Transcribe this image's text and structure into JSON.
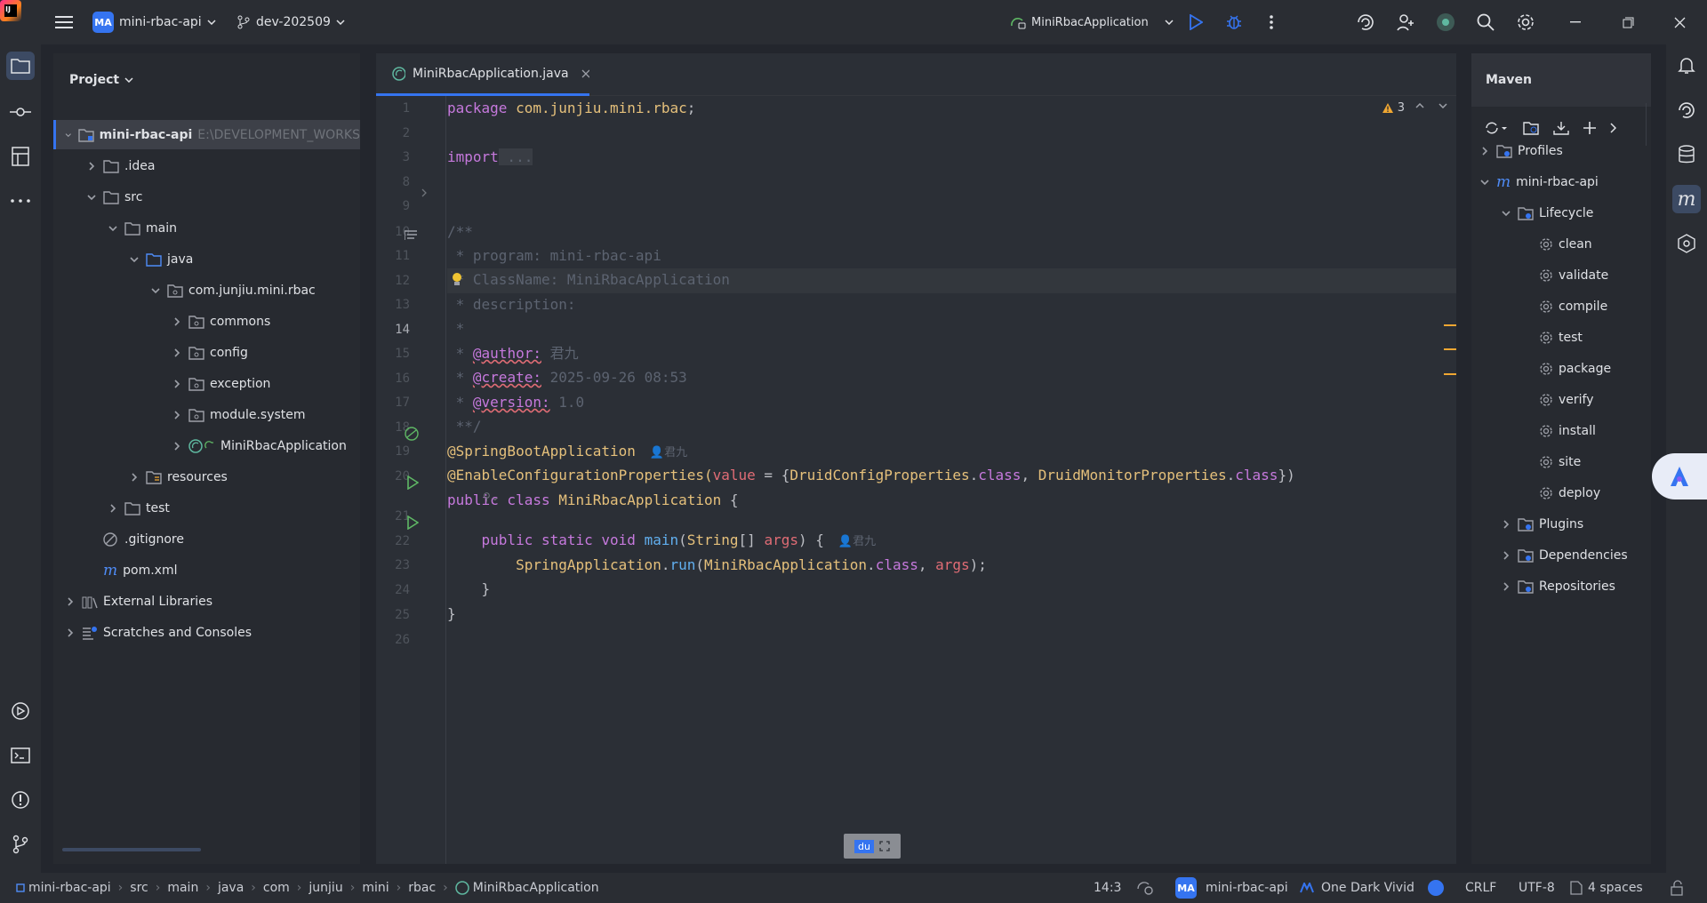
{
  "titlebar": {
    "project_badge": "MA",
    "project_name": "mini-rbac-api",
    "branch": "dev-202509",
    "run_config": "MiniRbacApplication",
    "logo_text": "IJ"
  },
  "project_panel": {
    "title": "Project",
    "tree": [
      {
        "label": "mini-rbac-api",
        "hint": "E:\\DEVELOPMENT_WORKS",
        "icon": "module-folder",
        "depth": 0,
        "expanded": true
      },
      {
        "label": ".idea",
        "icon": "folder",
        "depth": 1,
        "expanded": false
      },
      {
        "label": "src",
        "icon": "folder",
        "depth": 1,
        "expanded": true
      },
      {
        "label": "main",
        "icon": "folder",
        "depth": 2,
        "expanded": true
      },
      {
        "label": "java",
        "icon": "source-folder",
        "depth": 3,
        "expanded": true
      },
      {
        "label": "com.junjiu.mini.rbac",
        "icon": "package",
        "depth": 4,
        "expanded": true
      },
      {
        "label": "commons",
        "icon": "package",
        "depth": 5,
        "expanded": false
      },
      {
        "label": "config",
        "icon": "package",
        "depth": 5,
        "expanded": false
      },
      {
        "label": "exception",
        "icon": "package",
        "depth": 5,
        "expanded": false
      },
      {
        "label": "module.system",
        "icon": "package",
        "depth": 5,
        "expanded": false
      },
      {
        "label": "MiniRbacApplication",
        "icon": "spring-class",
        "depth": 5,
        "expanded": false
      },
      {
        "label": "resources",
        "icon": "resources-folder",
        "depth": 3,
        "expanded": false
      },
      {
        "label": "test",
        "icon": "folder",
        "depth": 2,
        "expanded": false
      },
      {
        "label": ".gitignore",
        "icon": "ignore-file",
        "depth": 1
      },
      {
        "label": "pom.xml",
        "icon": "maven-file",
        "depth": 1
      },
      {
        "label": "External Libraries",
        "icon": "libraries",
        "depth": 0,
        "expanded": false
      },
      {
        "label": "Scratches and Consoles",
        "icon": "scratches",
        "depth": 0,
        "expanded": false
      }
    ]
  },
  "editor": {
    "tab_label": "MiniRbacApplication.java",
    "warnings_count": "3",
    "line_numbers": [
      "1",
      "2",
      "3",
      "8",
      "9",
      "10",
      "11",
      "12",
      "13",
      "14",
      "15",
      "16",
      "17",
      "18",
      "19",
      "20",
      "21",
      "22",
      "23",
      "24",
      "25",
      "26"
    ],
    "lines": {
      "l1_kw": "package",
      "l1_pkg": " com.junjiu.mini.rbac",
      "l1_end": ";",
      "l3_kw": "import",
      "l3_rest": " ...",
      "l10": "/**",
      "l11": " * program: mini-rbac-api",
      "l12": " * ClassName: MiniRbacApplication",
      "l13": " * description:",
      "l14": " *",
      "l15_pre": " * ",
      "l15_tag": "@author:",
      "l15_val": " 君九",
      "l16_pre": " * ",
      "l16_tag": "@create:",
      "l16_val": " 2025-09-26 08:53",
      "l17_pre": " * ",
      "l17_tag": "@version:",
      "l17_val": " 1.0",
      "l18": " **/",
      "l19_ann": "@SpringBootApplication",
      "l19_author": "君九",
      "l20_ann": "@EnableConfigurationProperties(",
      "l20_param": "value",
      "l20_mid": " = {",
      "l20_c1": "DruidConfigProperties",
      "l20_dot1": ".",
      "l20_class1": "class",
      "l20_comma": ", ",
      "l20_c2": "DruidMonitorProperties",
      "l20_dot2": ".",
      "l20_class2": "class",
      "l20_end": "})",
      "l21_kw": "public class ",
      "l21_name": "MiniRbacApplication",
      "l21_end": " {",
      "l22_kw": "    public static void ",
      "l22_fn": "main",
      "l22_open": "(",
      "l22_type": "String",
      "l22_arr": "[] ",
      "l22_param": "args",
      "l22_end": ") {",
      "l22_author": "君九",
      "l23_cls": "        SpringApplication",
      "l23_dot": ".",
      "l23_fn": "run",
      "l23_open": "(",
      "l23_cls2": "MiniRbacApplication",
      "l23_dot2": ".",
      "l23_kw": "class",
      "l23_comma": ", ",
      "l23_param": "args",
      "l23_end": ");",
      "l24": "    }",
      "l25": "}"
    },
    "floating_toolbar_label": "du"
  },
  "maven_panel": {
    "title": "Maven",
    "items": [
      {
        "label": "Profiles",
        "icon": "profiles-folder",
        "depth": 0
      },
      {
        "label": "mini-rbac-api",
        "icon": "maven-module",
        "depth": 0
      },
      {
        "label": "Lifecycle",
        "icon": "lifecycle-folder",
        "depth": 1
      },
      {
        "label": "clean",
        "icon": "gear",
        "depth": 2
      },
      {
        "label": "validate",
        "icon": "gear",
        "depth": 2
      },
      {
        "label": "compile",
        "icon": "gear",
        "depth": 2
      },
      {
        "label": "test",
        "icon": "gear",
        "depth": 2
      },
      {
        "label": "package",
        "icon": "gear",
        "depth": 2
      },
      {
        "label": "verify",
        "icon": "gear",
        "depth": 2
      },
      {
        "label": "install",
        "icon": "gear",
        "depth": 2
      },
      {
        "label": "site",
        "icon": "gear",
        "depth": 2
      },
      {
        "label": "deploy",
        "icon": "gear",
        "depth": 2
      },
      {
        "label": "Plugins",
        "icon": "plugins-folder",
        "depth": 1
      },
      {
        "label": "Dependencies",
        "icon": "dependencies-folder",
        "depth": 1
      },
      {
        "label": "Repositories",
        "icon": "repositories-folder",
        "depth": 1
      }
    ]
  },
  "statusbar": {
    "breadcrumbs": [
      "mini-rbac-api",
      "src",
      "main",
      "java",
      "com",
      "junjiu",
      "mini",
      "rbac",
      "MiniRbacApplication"
    ],
    "caret": "14:3",
    "project_badge": "MA",
    "project_name": "mini-rbac-api",
    "theme": "One Dark Vivid",
    "line_sep": "CRLF",
    "encoding": "UTF-8",
    "indent": "4 spaces"
  },
  "colors": {
    "accent": "#3574f0",
    "warning": "#f0a732",
    "run_green": "#5fb865"
  }
}
